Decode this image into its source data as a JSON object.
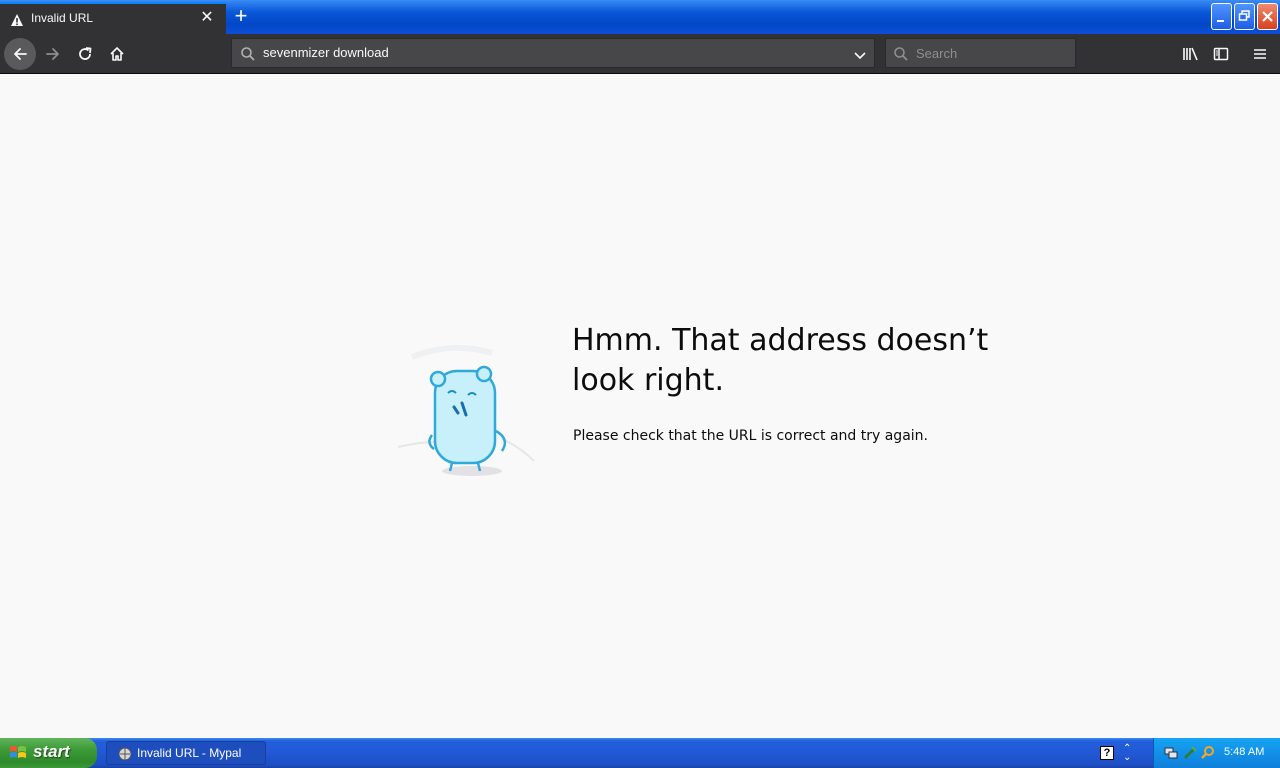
{
  "tab": {
    "title": "Invalid URL",
    "icon": "warning-icon"
  },
  "toolbar": {
    "url_value": "sevenmizer download",
    "search_placeholder": "Search"
  },
  "error": {
    "title": "Hmm. That address doesn’t look right.",
    "description": "Please check that the URL is correct and try again."
  },
  "taskbar": {
    "start_label": "start",
    "task_label": "Invalid URL - Mypal",
    "clock": "5:48 AM"
  },
  "colors": {
    "tab_accent": "#0a84ff",
    "toolbar_bg": "#323234",
    "content_bg": "#f9f9fa",
    "xp_blue": "#245edb",
    "start_green": "#3c9a37"
  }
}
